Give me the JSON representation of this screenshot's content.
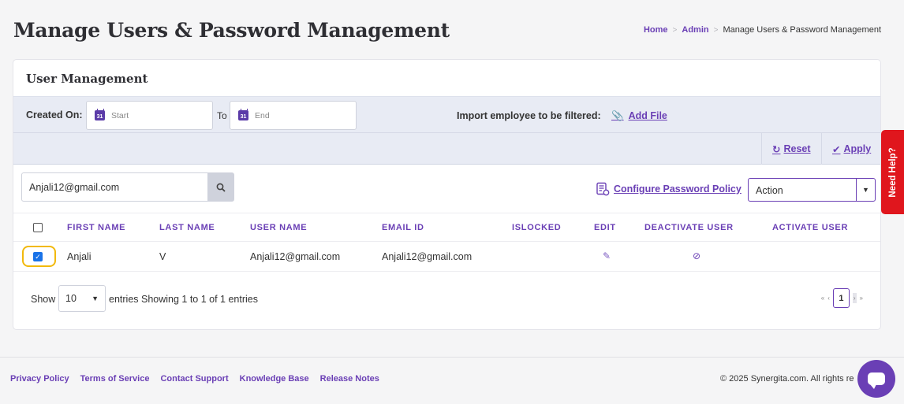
{
  "header": {
    "title": "Manage Users & Password Management"
  },
  "breadcrumb": {
    "home": "Home",
    "admin": "Admin",
    "current": "Manage Users & Password Management",
    "sep": ">"
  },
  "card": {
    "title": "User Management"
  },
  "filters": {
    "created_on_label": "Created On:",
    "start_placeholder": "Start",
    "to_label": "To",
    "end_placeholder": "End",
    "calendar_day": "31",
    "import_label": "Import employee to be filtered:",
    "add_file_label": "Add File"
  },
  "actions": {
    "reset_label": "Reset",
    "apply_label": "Apply"
  },
  "search": {
    "value": "Anjali12@gmail.com"
  },
  "toolbar": {
    "configure_policy_label": "Configure Password Policy",
    "action_select_value": "Action"
  },
  "table": {
    "columns": [
      "FIRST NAME",
      "LAST NAME",
      "USER NAME",
      "EMAIL ID",
      "ISLOCKED",
      "EDIT",
      "DEACTIVATE USER",
      "ACTIVATE USER"
    ],
    "rows": [
      {
        "first_name": "Anjali",
        "last_name": "V",
        "user_name": "Anjali12@gmail.com",
        "email": "Anjali12@gmail.com",
        "islocked": "",
        "checked": true
      }
    ]
  },
  "pagination": {
    "show_label": "Show",
    "page_length": "10",
    "entries_text": "entries Showing 1 to 1 of 1 entries",
    "current_page": "1",
    "first_symbol": "«",
    "prev_symbol": "‹",
    "next_symbol": "›",
    "last_symbol": "»"
  },
  "help_tab": {
    "label": "Need Help?"
  },
  "footer": {
    "links": [
      "Privacy Policy",
      "Terms of Service",
      "Contact Support",
      "Knowledge Base",
      "Release Notes"
    ],
    "copyright": "© 2025 Synergita.com. All rights re"
  },
  "colors": {
    "brand": "#6a3fb5",
    "help": "#e0161d",
    "highlight": "#f2b90c",
    "checkbox": "#1a73e8"
  },
  "icons": {
    "calendar": "calendar-icon",
    "paperclip": "paperclip-icon",
    "refresh": "refresh-icon",
    "check_circle": "check-circle-icon",
    "search": "search-icon",
    "policy": "policy-icon",
    "edit": "edit-icon",
    "ban": "ban-icon",
    "chat": "chat-icon"
  }
}
